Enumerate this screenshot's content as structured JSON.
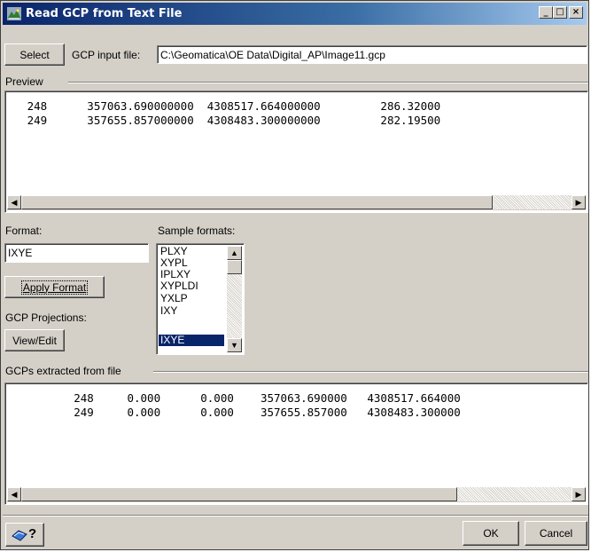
{
  "window": {
    "title": "Read GCP from Text File"
  },
  "titlebar_buttons": {
    "minimize": "_",
    "maximize": "□",
    "close": "×"
  },
  "toolbar": {
    "select_label": "Select",
    "input_label": "GCP input file:",
    "input_value": "C:\\Geomatica\\OE Data\\Digital_AP\\Image11.gcp"
  },
  "preview": {
    "legend": "Preview",
    "rows": [
      "   248      357063.690000000  4308517.664000000         286.32000",
      "   249      357655.857000000  4308483.300000000         282.19500"
    ]
  },
  "format": {
    "label": "Format:",
    "value": "IXYE",
    "apply_label": "Apply Format"
  },
  "sample_formats": {
    "label": "Sample formats:",
    "items": [
      "PLXY",
      "XYPL",
      "IPLXY",
      "XYPLDI",
      "YXLP",
      "IXY",
      "IXYE"
    ],
    "selected": "IXYE"
  },
  "projections": {
    "label": "GCP Projections:",
    "view_label": "View/Edit"
  },
  "extracted": {
    "legend": "GCPs extracted from file",
    "rows": [
      "          248     0.000      0.000    357063.690000   4308517.664000",
      "          249     0.000      0.000    357655.857000   4308483.300000"
    ]
  },
  "footer": {
    "help_label": "?",
    "ok_label": "OK",
    "cancel_label": "Cancel"
  },
  "scroll_arrows": {
    "left": "◀",
    "right": "▶",
    "up": "▲",
    "down": "▼"
  }
}
